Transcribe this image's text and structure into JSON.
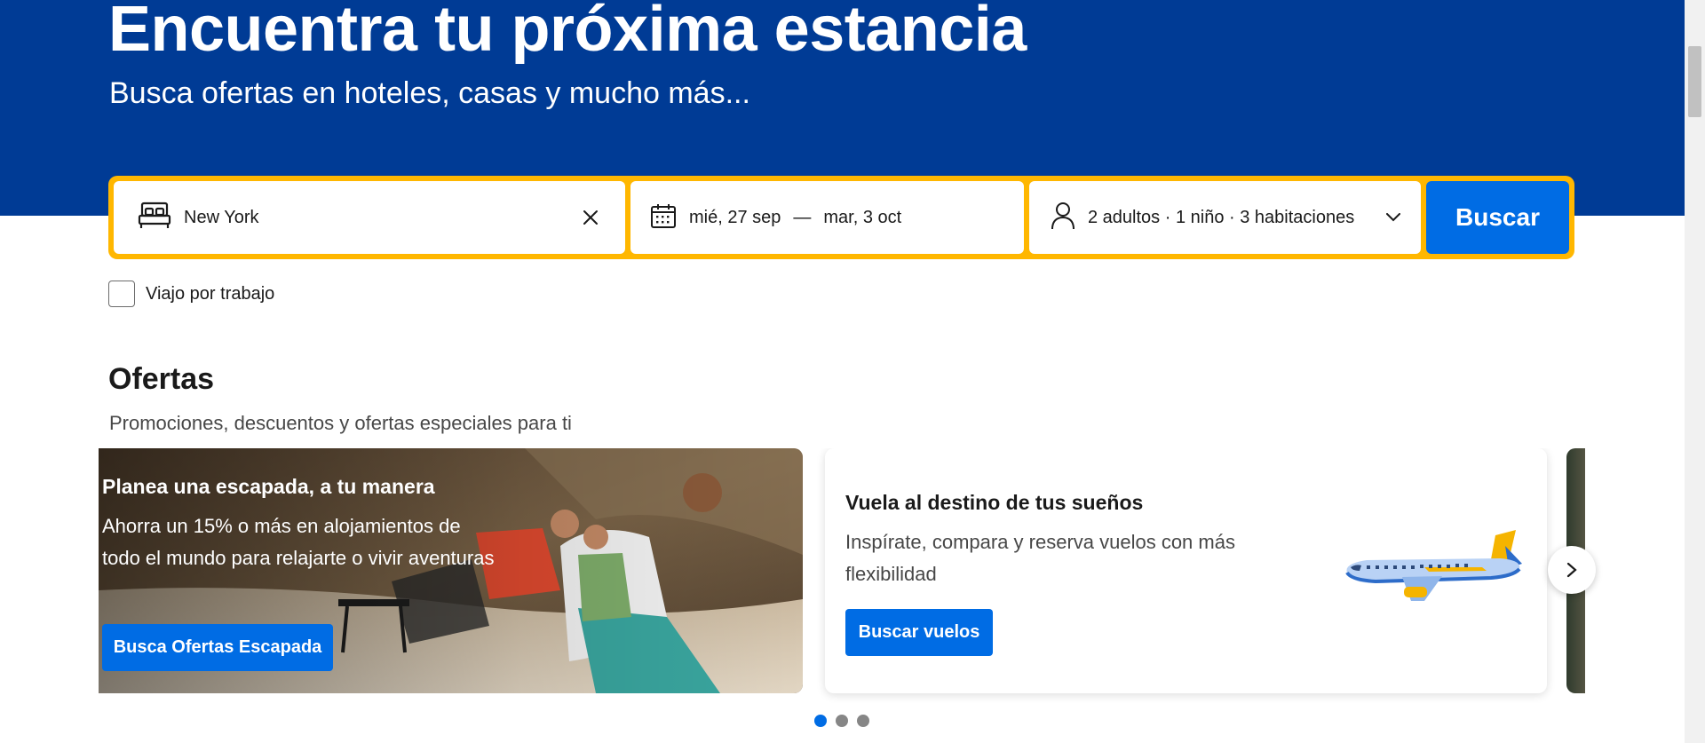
{
  "hero": {
    "title": "Encuentra tu próxima estancia",
    "subtitle": "Busca ofertas en hoteles, casas y mucho más..."
  },
  "search": {
    "destination_value": "New York",
    "bed_icon": "bed-icon",
    "clear_icon": "close-icon",
    "calendar_icon": "calendar-icon",
    "checkin": "mié, 27 sep",
    "date_separator": "—",
    "checkout": "mar, 3 oct",
    "person_icon": "person-icon",
    "guests": "2 adultos · 1 niño · 3 habitaciones",
    "chevron_icon": "chevron-down-icon",
    "button_label": "Buscar"
  },
  "work_trip": {
    "label": "Viajo por trabajo",
    "checked": false
  },
  "offers": {
    "title": "Ofertas",
    "subtitle": "Promociones, descuentos y ofertas especiales para ti",
    "cards": [
      {
        "title": "Planea una escapada, a tu manera",
        "text": "Ahorra un 15% o más en alojamientos de todo el mundo para relajarte o vivir aventuras",
        "button": "Busca Ofertas Escapada"
      },
      {
        "title": "Vuela al destino de tus sueños",
        "text": "Inspírate, compara y reserva vuelos con más flexibilidad",
        "button": "Buscar vuelos"
      }
    ],
    "next_icon": "chevron-right-icon",
    "pagination": {
      "count": 3,
      "active": 1
    }
  },
  "colors": {
    "hero_bg": "#003b95",
    "search_border": "#ffb700",
    "primary_button": "#006ce4",
    "active_dot": "#006ce4",
    "inactive_dot": "#868686"
  }
}
